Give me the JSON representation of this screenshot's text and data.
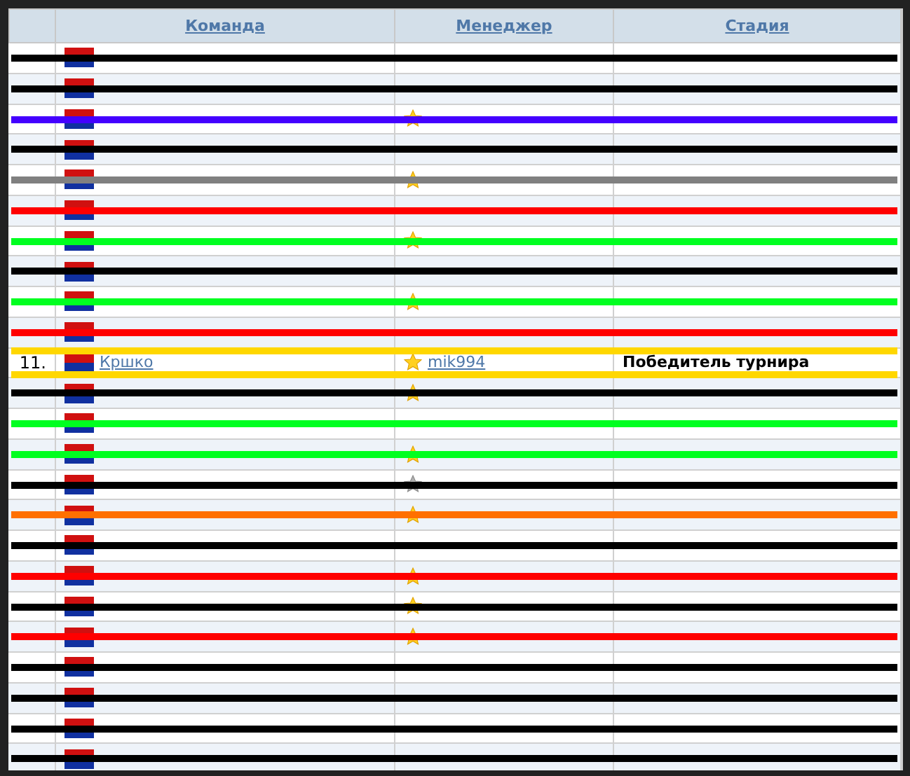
{
  "table": {
    "columns": [
      "Команда",
      "Менеджер",
      "Стадия"
    ],
    "rows": [
      {
        "starred": false,
        "winner": false,
        "color": "#000000"
      },
      {
        "starred": false,
        "winner": false,
        "color": "#000000"
      },
      {
        "starred": true,
        "faded": false,
        "winner": false,
        "color": "#4400ff"
      },
      {
        "starred": false,
        "winner": false,
        "color": "#000000"
      },
      {
        "starred": true,
        "faded": false,
        "winner": false,
        "color": "#808080"
      },
      {
        "starred": false,
        "winner": false,
        "color": "#ff0000"
      },
      {
        "starred": true,
        "faded": false,
        "winner": false,
        "color": "#00ff20"
      },
      {
        "starred": false,
        "winner": false,
        "color": "#000000"
      },
      {
        "starred": true,
        "faded": false,
        "winner": false,
        "color": "#00ff20"
      },
      {
        "starred": false,
        "winner": false,
        "color": "#ff0000"
      },
      {
        "num": "11.",
        "team": "Кршко",
        "manager": "mik994",
        "starred": true,
        "faded": false,
        "stage": "Победитель турнира",
        "winner": true,
        "color": "#ffd700"
      },
      {
        "starred": true,
        "faded": false,
        "winner": false,
        "color": "#000000"
      },
      {
        "starred": false,
        "winner": false,
        "color": "#00ff20"
      },
      {
        "starred": true,
        "faded": false,
        "winner": false,
        "color": "#00ff20"
      },
      {
        "starred": true,
        "faded": true,
        "winner": false,
        "color": "#000000"
      },
      {
        "starred": true,
        "faded": false,
        "winner": false,
        "color": "#ff7000"
      },
      {
        "starred": false,
        "winner": false,
        "color": "#000000"
      },
      {
        "starred": true,
        "faded": false,
        "winner": false,
        "color": "#ff0000"
      },
      {
        "starred": true,
        "faded": false,
        "winner": false,
        "color": "#000000"
      },
      {
        "starred": true,
        "faded": false,
        "winner": false,
        "color": "#ff0000"
      },
      {
        "starred": false,
        "winner": false,
        "color": "#000000"
      },
      {
        "starred": false,
        "winner": false,
        "color": "#000000"
      },
      {
        "starred": false,
        "winner": false,
        "color": "#000000"
      },
      {
        "starred": false,
        "winner": false,
        "color": "#000000"
      }
    ]
  }
}
